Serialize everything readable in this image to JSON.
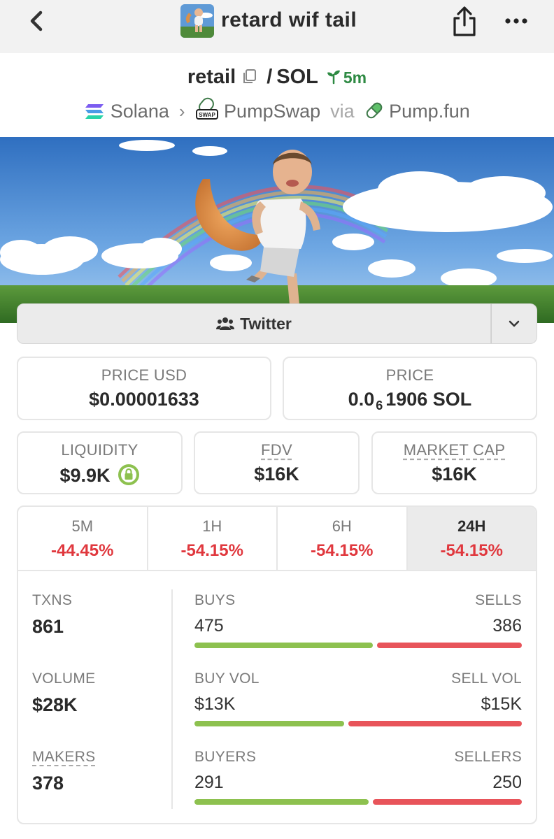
{
  "header": {
    "token_name": "retard wif tail"
  },
  "pair": {
    "base": "retail",
    "separator": "/",
    "quote": "SOL",
    "age": "5m"
  },
  "route": {
    "chain": "Solana",
    "dex": "PumpSwap",
    "dex_badge": "SWAP",
    "via_label": "via",
    "launchpad": "Pump.fun"
  },
  "social": {
    "twitter_label": "Twitter"
  },
  "prices": {
    "price_usd_label": "PRICE USD",
    "price_usd": "$0.00001633",
    "price_label": "PRICE",
    "price_native_prefix": "0.0",
    "price_native_zeros": "6",
    "price_native_digits": "1906 SOL"
  },
  "metrics": {
    "liquidity_label": "LIQUIDITY",
    "liquidity": "$9.9K",
    "fdv_label": "FDV",
    "fdv": "$16K",
    "mcap_label": "MARKET CAP",
    "mcap": "$16K"
  },
  "timeframes": [
    {
      "label": "5M",
      "change": "-44.45%"
    },
    {
      "label": "1H",
      "change": "-54.15%"
    },
    {
      "label": "6H",
      "change": "-54.15%"
    },
    {
      "label": "24H",
      "change": "-54.15%"
    }
  ],
  "activity": {
    "txns_label": "TXNS",
    "txns": "861",
    "volume_label": "VOLUME",
    "volume": "$28K",
    "makers_label": "MAKERS",
    "makers": "378",
    "buys_label": "BUYS",
    "buys": "475",
    "sells_label": "SELLS",
    "sells": "386",
    "buy_vol_label": "BUY VOL",
    "buy_vol": "$13K",
    "sell_vol_label": "SELL VOL",
    "sell_vol": "$15K",
    "buyers_label": "BUYERS",
    "buyers": "291",
    "sellers_label": "SELLERS",
    "sellers": "250"
  },
  "bar_ratios": {
    "txns_buy_fraction": 0.552,
    "volume_buy_fraction": 0.464,
    "makers_buy_fraction": 0.538
  },
  "colors": {
    "positive": "#8dc14f",
    "negative": "#e8545a",
    "change_negative_text": "#e0383e",
    "age_green": "#2e8a43"
  }
}
